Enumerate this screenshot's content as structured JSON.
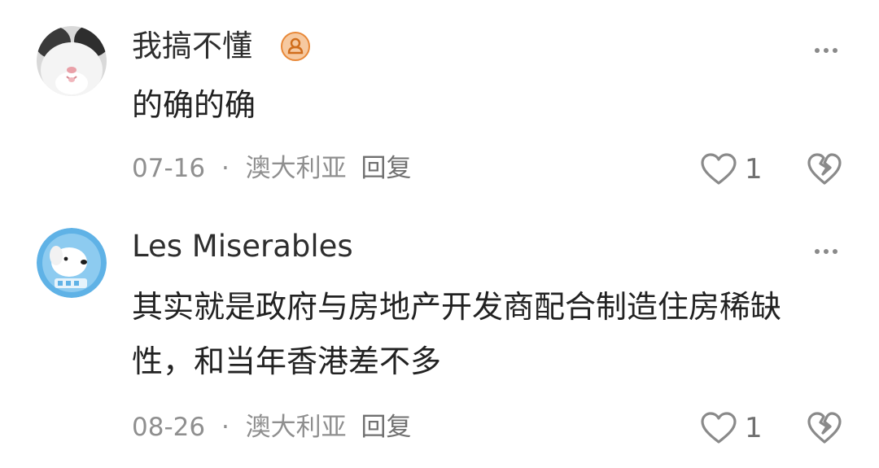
{
  "comments": [
    {
      "username": "我搞不懂",
      "has_badge": true,
      "content": "的确的确",
      "date": "07-16",
      "separator": "·",
      "location": "澳大利亚",
      "reply_label": "回复",
      "like_count": "1",
      "avatar_icon": "cat-avatar-icon"
    },
    {
      "username": "Les Miserables",
      "has_badge": false,
      "content": "其实就是政府与房地产开发商配合制造住房稀缺性，和当年香港差不多",
      "date": "08-26",
      "separator": "·",
      "location": "澳大利亚",
      "reply_label": "回复",
      "like_count": "1",
      "avatar_icon": "dog-avatar-icon"
    }
  ],
  "colors": {
    "text_primary": "#222222",
    "text_secondary": "#8f8f8f",
    "badge_orange": "#e88838",
    "icon_gray": "#8a8a8a"
  }
}
